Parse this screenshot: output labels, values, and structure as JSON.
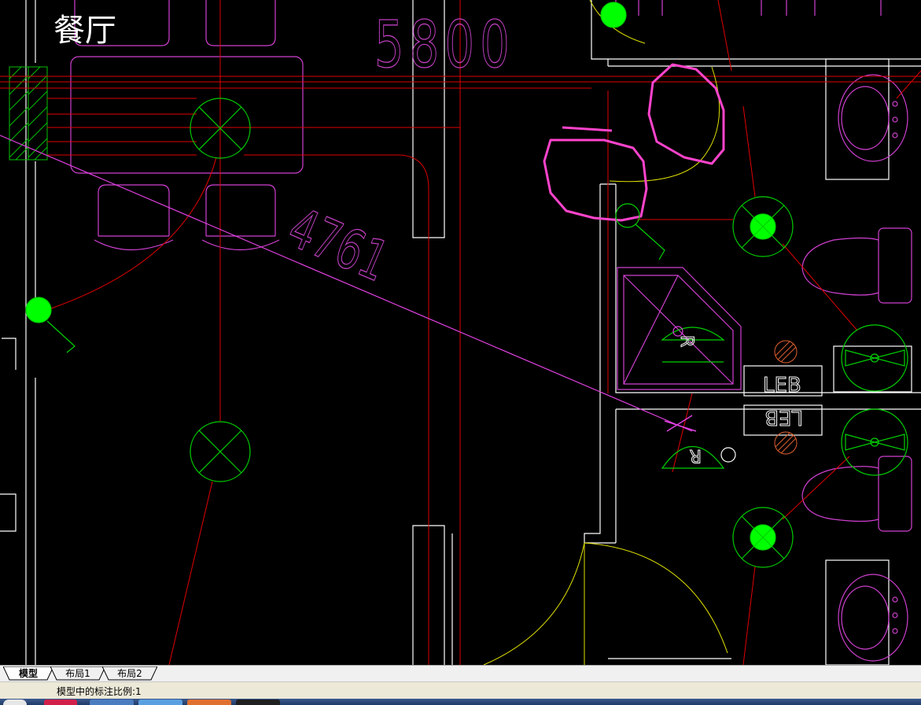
{
  "drawing": {
    "room_label": "餐厅",
    "dim_top": "5800",
    "dim_diagonal": "4761",
    "fixture_label_upper": "LEB",
    "fixture_label_lower": "LEB",
    "basin_mark_upper": "R",
    "basin_mark_lower": "R"
  },
  "tabs": [
    {
      "label": "模型",
      "active": true
    },
    {
      "label": "布局1",
      "active": false
    },
    {
      "label": "布局2",
      "active": false
    }
  ],
  "status": {
    "text": "模型中的标注比例:1"
  },
  "colors": {
    "background": "#000000",
    "walls": "#ffffff",
    "furniture": "#ff00ff",
    "fixtures": "#00ff00",
    "wiring": "#ff0000",
    "door_arcs": "#ffff00",
    "revision_clouds": "#ff44cc",
    "dimensions": "#c040c0"
  },
  "icons": [
    "ceiling-light-icon",
    "wall-light-icon",
    "downlight-icon",
    "exhaust-fan-icon",
    "hatch-icon"
  ]
}
